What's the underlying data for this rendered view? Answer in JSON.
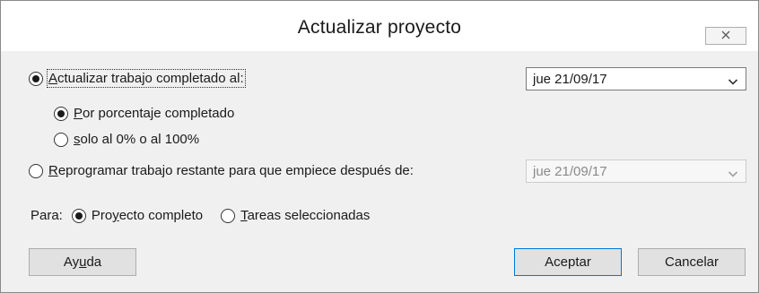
{
  "dialog": {
    "title": "Actualizar proyecto",
    "close_icon": "close-icon"
  },
  "update_completed": {
    "pre": "",
    "mnemonic": "A",
    "post": "ctualizar trabajo completado al:",
    "checked": true,
    "date_value": "jue 21/09/17"
  },
  "by_percent": {
    "mnemonic": "P",
    "post": "or porcentaje completado",
    "checked": true
  },
  "only_0_100": {
    "mnemonic": "s",
    "post": "olo al 0% o al 100%",
    "checked": false
  },
  "reschedule": {
    "mnemonic": "R",
    "post": "eprogramar trabajo restante para que empiece después de:",
    "checked": false,
    "date_value": "jue 21/09/17"
  },
  "scope": {
    "label": "Para:",
    "entire_pre": "Pro",
    "entire_mnemonic": "y",
    "entire_post": "ecto completo",
    "entire_checked": true,
    "selected_mnemonic": "T",
    "selected_post": "areas seleccionadas",
    "selected_checked": false
  },
  "buttons": {
    "help_pre": "Ay",
    "help_mnemonic": "u",
    "help_post": "da",
    "ok": "Aceptar",
    "cancel": "Cancelar"
  },
  "icons": {
    "close": "close-icon",
    "dropdown": "chevron-down-icon"
  }
}
